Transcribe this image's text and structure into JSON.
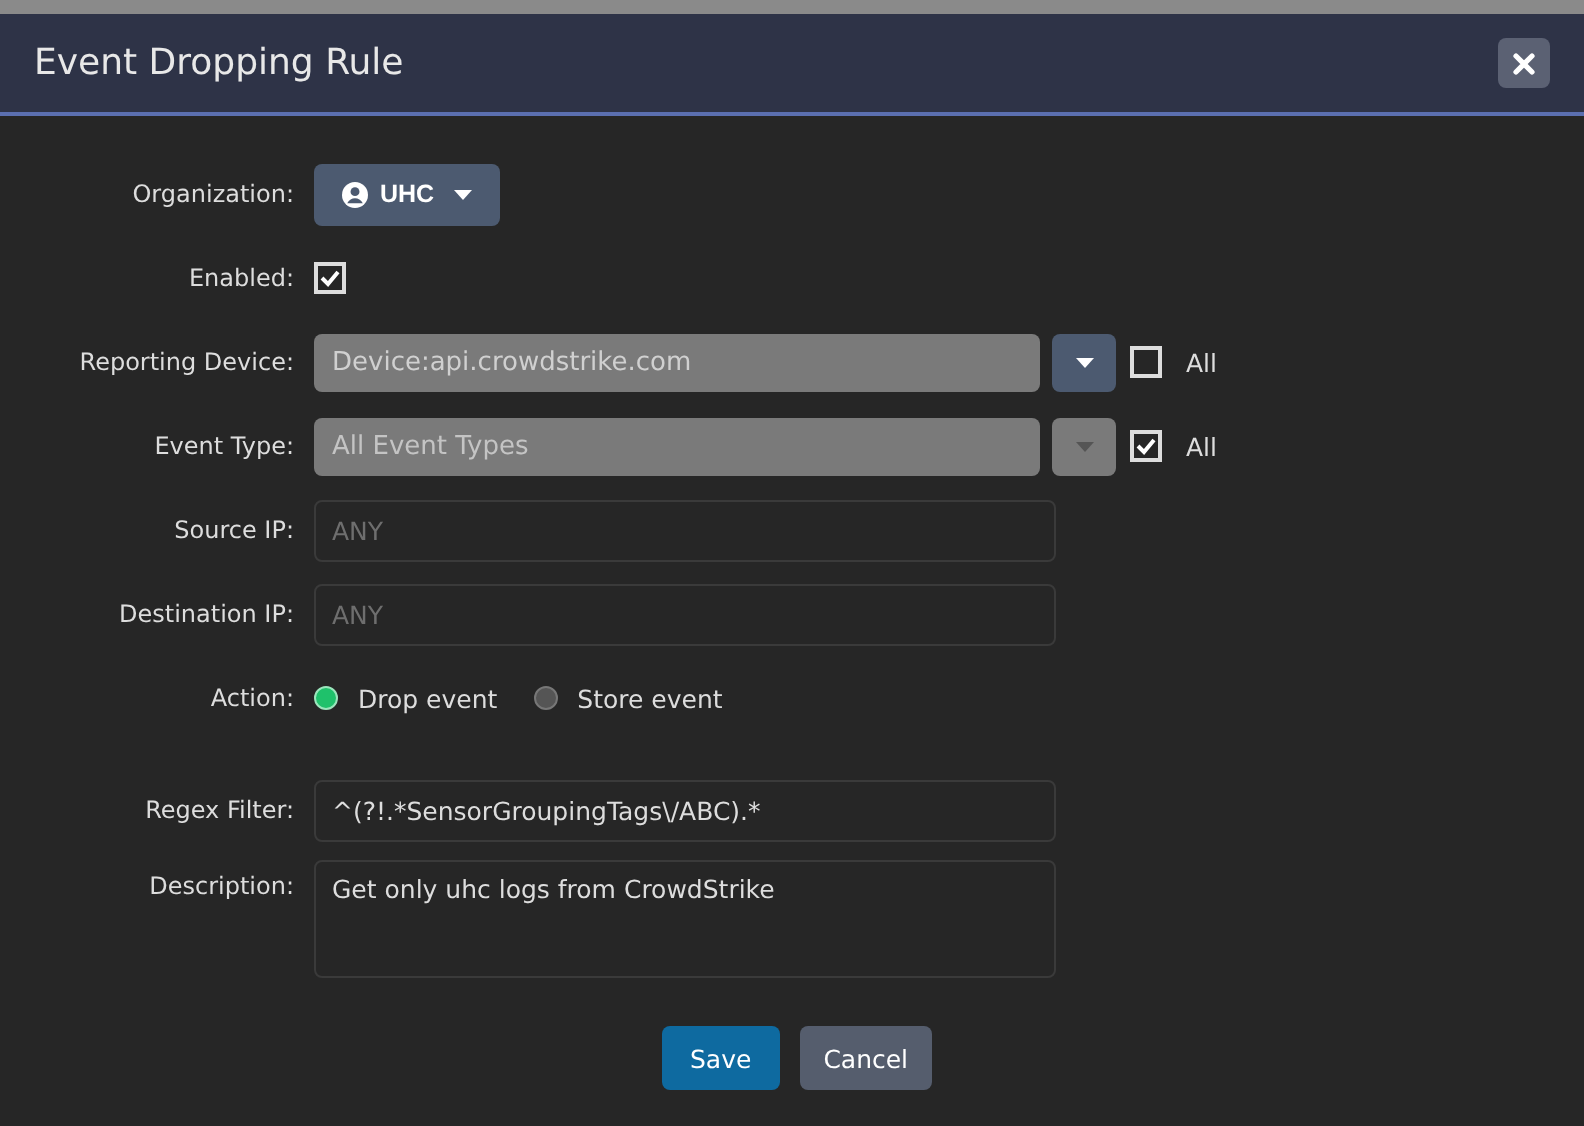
{
  "dialog": {
    "title": "Event Dropping Rule"
  },
  "fields": [
    {
      "kind": "dropdown_button",
      "label": "Organization:",
      "value": "UHC"
    },
    {
      "kind": "checkbox",
      "label": "Enabled:",
      "checked": true
    },
    {
      "kind": "select",
      "label": "Reporting Device:",
      "value": "Device:api.crowdstrike.com",
      "disabled": false,
      "all_label": "All",
      "all_checked": false
    },
    {
      "kind": "select",
      "label": "Event Type:",
      "value": "All Event Types",
      "disabled": true,
      "all_label": "All",
      "all_checked": true
    },
    {
      "kind": "text",
      "label": "Source IP:",
      "placeholder": "ANY"
    },
    {
      "kind": "text",
      "label": "Destination IP:",
      "placeholder": "ANY"
    },
    {
      "kind": "radio",
      "label": "Action:",
      "options": [
        {
          "label": "Drop event",
          "selected": true
        },
        {
          "label": "Store event",
          "selected": false
        }
      ]
    },
    {
      "kind": "text",
      "label": "Regex Filter:",
      "value": "^(?!.*SensorGroupingTags\\/ABC).*"
    },
    {
      "kind": "textarea",
      "label": "Description:",
      "value": "Get only uhc logs from CrowdStrike"
    }
  ],
  "buttons": [
    {
      "label": "Save",
      "kind": "primary"
    },
    {
      "label": "Cancel",
      "kind": "secondary"
    }
  ]
}
